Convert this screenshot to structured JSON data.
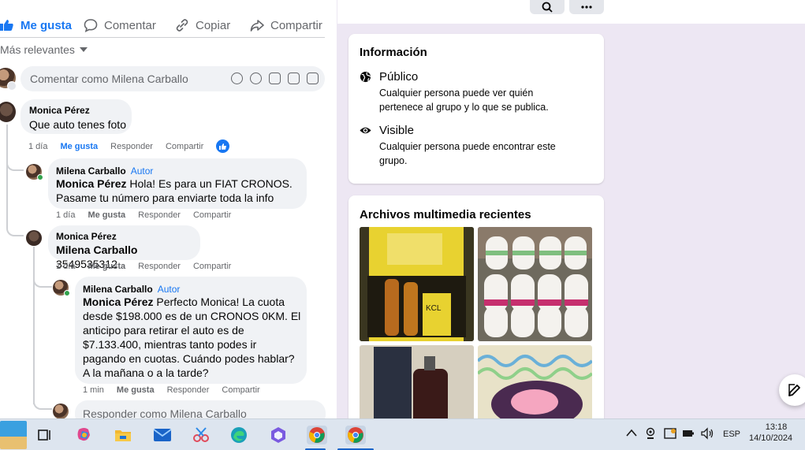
{
  "post_actions": {
    "like": "Me gusta",
    "comment": "Comentar",
    "copy": "Copiar",
    "share": "Compartir"
  },
  "sort_label": "Más relevantes",
  "comment_input": {
    "placeholder": "Comentar como Milena Carballo"
  },
  "comments": [
    {
      "author": "Monica Pérez",
      "text": "Que auto tenes foto",
      "time": "1 día",
      "like": "Me gusta",
      "reply": "Responder",
      "share": "Compartir"
    },
    {
      "author": "Milena Carballo",
      "badge": "Autor",
      "mention": "Monica Pérez",
      "text": " Hola! Es para un FIAT CRONOS. Pasame tu número para enviarte toda la info",
      "time": "1 día",
      "like": "Me gusta",
      "reply": "Responder",
      "share": "Compartir"
    },
    {
      "author": "Monica Pérez",
      "mention": "Milena Carballo",
      "text": " 3549535312",
      "time": "1 día",
      "like": "Me gusta",
      "reply": "Responder",
      "share": "Compartir"
    },
    {
      "author": "Milena Carballo",
      "badge": "Autor",
      "mention": "Monica Pérez",
      "text": " Perfecto Monica! La cuota desde $198.000 es de un CRONOS 0KM. El anticipo para retirar el auto es de $7.133.400, mientras tanto podes ir pagando en cuotas. Cuándo podes hablar? A la mañana o a la tarde?",
      "time": "1 min",
      "like": "Me gusta",
      "reply": "Responder",
      "share": "Compartir"
    }
  ],
  "reply_input": {
    "placeholder": "Responder como Milena Carballo"
  },
  "info_card": {
    "title": "Información",
    "items": [
      {
        "icon": "globe-icon",
        "title": "Público",
        "desc": "Cualquier persona puede ver quién pertenece al grupo y lo que se publica."
      },
      {
        "icon": "eye-icon",
        "title": "Visible",
        "desc": "Cualquier persona puede encontrar este grupo."
      }
    ]
  },
  "media_card": {
    "title": "Archivos multimedia recientes"
  },
  "taskbar": {
    "lang": "ESP",
    "time": "13:18",
    "date": "14/10/2024"
  },
  "colors": {
    "accent": "#1877f2",
    "bg": "#ede7f3",
    "comment_bg": "#f0f2f5"
  }
}
